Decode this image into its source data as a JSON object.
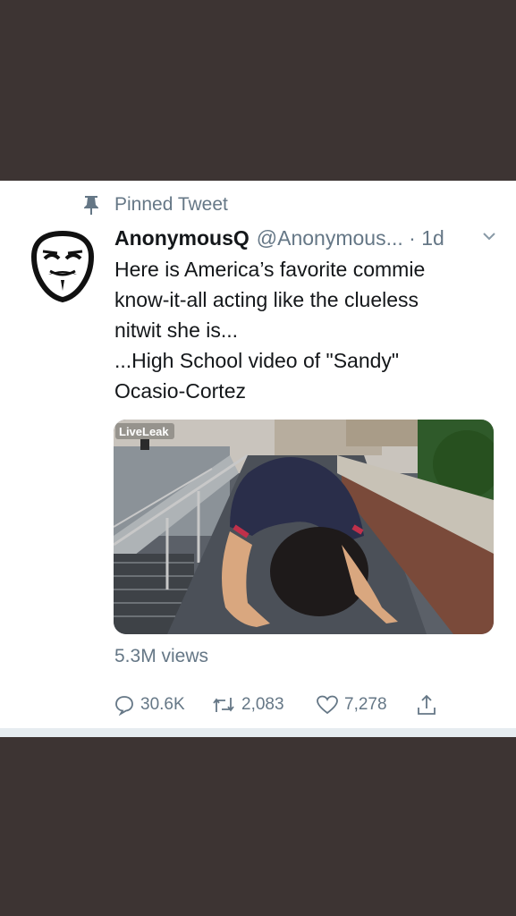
{
  "tweet": {
    "pinned_label": "Pinned Tweet",
    "display_name": "AnonymousQ",
    "handle_time": "@Anonymous... · 1d",
    "text_lines": [
      "Here is America’s favorite commie",
      "know-it-all acting like the clueless",
      "nitwit she is...",
      "...High School video of \"Sandy\"",
      "Ocasio-Cortez"
    ],
    "media_watermark": "LiveLeak",
    "views": "5.3M views",
    "reply_count": "30.6K",
    "retweet_count": "2,083",
    "like_count": "7,278"
  },
  "icons": {
    "pin": "pin-icon",
    "avatar": "anonymous-mask-avatar",
    "more": "chevron-down-icon",
    "reply": "reply-icon",
    "retweet": "retweet-icon",
    "like": "heart-icon",
    "share": "share-icon"
  },
  "colors": {
    "background": "#3d3433",
    "card": "#ffffff",
    "text_primary": "#14171a",
    "text_secondary": "#657786"
  }
}
